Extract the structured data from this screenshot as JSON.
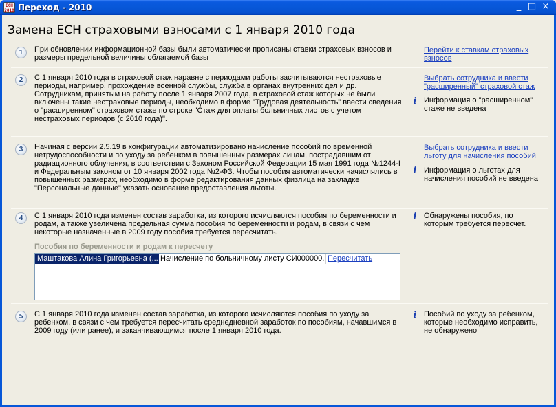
{
  "window": {
    "title": "Переход - 2010",
    "icon_label_top": "ЕСН",
    "icon_label_bottom": "2010",
    "minimize": "_",
    "maximize": "□",
    "close": "×"
  },
  "page_title": "Замена ЕСН страховыми взносами с 1 января 2010 года",
  "sections": [
    {
      "number": "1",
      "text": "При обновлении информационной базы были автоматически прописаны ставки страховых взносов и размеры предельной величины облагаемой базы",
      "link": "Перейти к ставкам страховых взносов"
    },
    {
      "number": "2",
      "text": "С 1 января 2010 года в страховой стаж наравне с периодами работы засчитываются нестраховые периоды, например, прохождение военной службы, служба в органах внутренних дел и др. Сотрудникам, принятым на работу после 1 января 2007 года, в страховой стаж которых не были включены такие нестраховые периоды, необходимо в форме \"Трудовая деятельность\" ввести сведения о \"расширенном\" страховом стаже по строке \"Стаж для оплаты больничных листов с учетом нестраховых периодов (с 2010 года)\".",
      "link": "Выбрать сотрудника и ввести \"расширенный\" страховой стаж",
      "info": "Информация о \"расширенном\" стаже не введена"
    },
    {
      "number": "3",
      "text": "Начиная с версии 2.5.19 в конфигурации автоматизировано начисление пособий по временной нетрудоспособности и по уходу за ребенком в повышенных размерах лицам, пострадавшим от радиационного облучения, в соответствии с Законом Российской Федерации 15 мая 1991 года №1244-I и Федеральным законом от 10 января 2002 года №2-ФЗ. Чтобы пособия автоматически начислялись в повышенных размерах, необходимо в форме редактирования данных физлица на закладке \"Персональные данные\" указать основание предоставления льготы.",
      "link": "Выбрать сотрудника и ввести льготу для начисления пособий",
      "info": "Информация о льготах для начисления пособий не введена"
    },
    {
      "number": "4",
      "text": "С 1 января 2010 года изменен состав заработка, из которого исчисляются пособия по беременности и родам, а также увеличена предельная сумма пособия по беременности и родам, в связи с чем некоторые назначенные в 2009 году пособия требуется пересчитать.",
      "info": "Обнаружены пособия, по которым требуется пересчет.",
      "list_header": "Пособия по беременности и родам к пересчету",
      "list_rows": [
        {
          "employee": "Маштакова Алина Григорьевна (...",
          "document": "Начисление по больничному листу СИ000000...",
          "action": "Пересчитать"
        }
      ]
    },
    {
      "number": "5",
      "text": "С 1 января 2010 года изменен состав заработка, из которого исчисляются пособия по уходу за ребенком, в связи с чем требуется пересчитать среднедневной заработок по пособиям, начавшимся в 2009 году (или ранее), и заканчивающимся после 1 января 2010 года.",
      "info": "Пособий по уходу за ребенком, которые необходимо исправить, не обнаружено"
    }
  ],
  "info_icon_glyph": "i"
}
